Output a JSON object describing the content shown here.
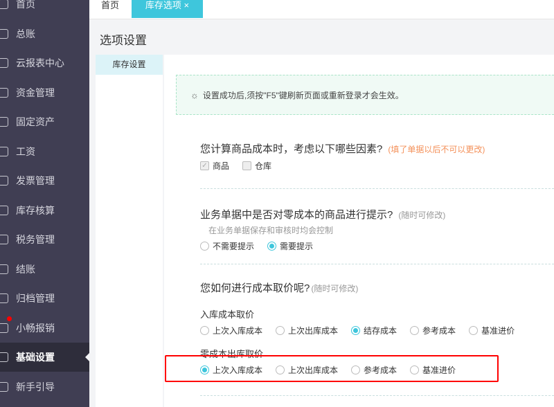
{
  "sidebar": {
    "items": [
      {
        "label": "首页",
        "icon": "home-icon"
      },
      {
        "label": "总账",
        "icon": "ledger-icon"
      },
      {
        "label": "云报表中心",
        "icon": "chart-icon"
      },
      {
        "label": "资金管理",
        "icon": "money-bag-icon"
      },
      {
        "label": "固定资产",
        "icon": "building-icon"
      },
      {
        "label": "工资",
        "icon": "salary-icon"
      },
      {
        "label": "发票管理",
        "icon": "invoice-icon"
      },
      {
        "label": "库存核算",
        "icon": "inventory-icon"
      },
      {
        "label": "税务管理",
        "icon": "tax-icon"
      },
      {
        "label": "结账",
        "icon": "checkout-icon"
      },
      {
        "label": "归档管理",
        "icon": "archive-icon"
      },
      {
        "label": "小畅报销",
        "icon": "reimburse-icon",
        "badge": true
      },
      {
        "label": "基础设置",
        "icon": "gear-icon",
        "active": true
      },
      {
        "label": "新手引导",
        "icon": "video-icon"
      }
    ]
  },
  "tabs": [
    {
      "label": "首页"
    },
    {
      "label": "库存选项",
      "active": true,
      "close": "×"
    }
  ],
  "page_title": "选项设置",
  "left_menu": [
    "库存设置"
  ],
  "notice": "设置成功后,须按\"F5\"键刷新页面或重新登录才会生效。",
  "q1": {
    "title": "您计算商品成本时，考虑以下哪些因素?",
    "note": "(填了单据以后不可以更改)",
    "options": [
      {
        "label": "商品",
        "checked": true
      },
      {
        "label": "仓库",
        "checked": false
      }
    ]
  },
  "q2": {
    "title": "业务单据中是否对零成本的商品进行提示?",
    "note": "(随时可修改)",
    "sub": "在业务单据保存和审核时均会控制",
    "options": [
      {
        "label": "不需要提示",
        "selected": false
      },
      {
        "label": "需要提示",
        "selected": true
      }
    ]
  },
  "q3": {
    "title": "您如何进行成本取价呢?",
    "note": "(随时可修改)",
    "in_label": "入库成本取价",
    "in_options": [
      {
        "label": "上次入库成本"
      },
      {
        "label": "上次出库成本"
      },
      {
        "label": "结存成本",
        "selected": true
      },
      {
        "label": "参考成本"
      },
      {
        "label": "基准进价"
      }
    ],
    "zero_label": "零成本出库取价",
    "zero_options": [
      {
        "label": "上次入库成本",
        "selected": true
      },
      {
        "label": "上次出库成本"
      },
      {
        "label": "参考成本"
      },
      {
        "label": "基准进价"
      }
    ]
  },
  "colors": {
    "accent": "#3ec6dc",
    "sidebar": "#403e53",
    "highlight": "#ff0000",
    "warn": "#f4915a"
  }
}
